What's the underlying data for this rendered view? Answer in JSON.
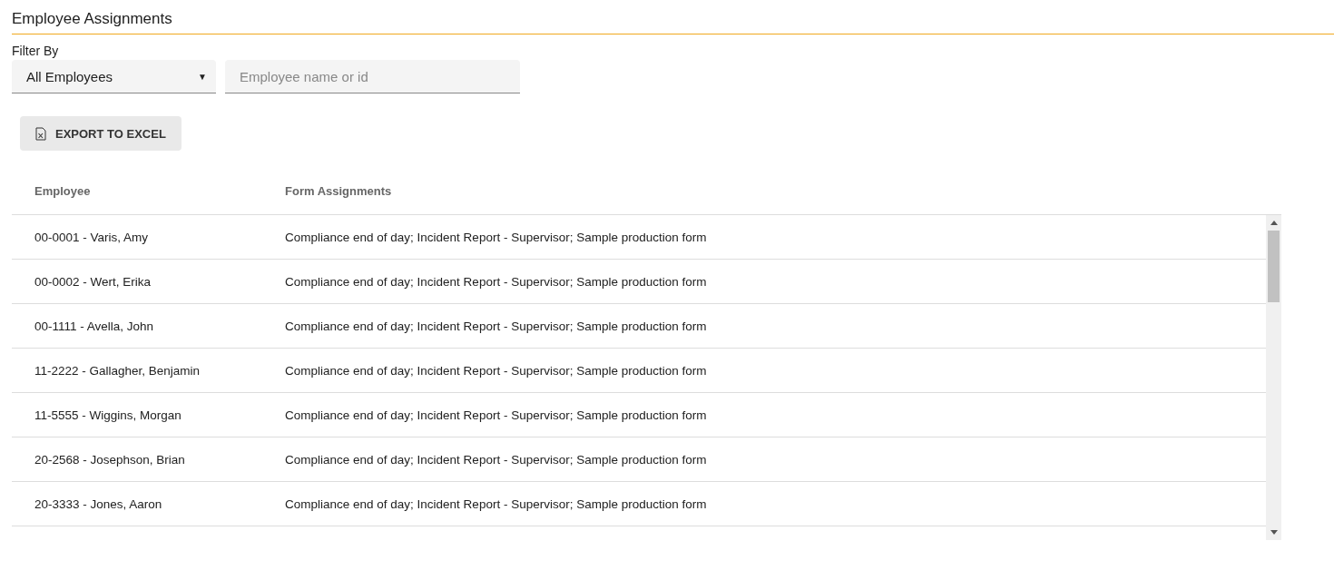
{
  "page_title": "Employee Assignments",
  "filter": {
    "label": "Filter By",
    "dropdown_value": "All Employees",
    "dropdown_caret": "▼",
    "search": {
      "placeholder": "Employee name or id"
    }
  },
  "export_button": {
    "label": "EXPORT TO EXCEL"
  },
  "table": {
    "columns": [
      "Employee",
      "Form Assignments"
    ],
    "rows": [
      {
        "employee": "00-0001 - Varis, Amy",
        "forms": "Compliance end of day; Incident Report - Supervisor; Sample production form"
      },
      {
        "employee": "00-0002 - Wert, Erika",
        "forms": "Compliance end of day; Incident Report - Supervisor; Sample production form"
      },
      {
        "employee": "00-1111 - Avella, John",
        "forms": "Compliance end of day; Incident Report - Supervisor; Sample production form"
      },
      {
        "employee": "11-2222 - Gallagher, Benjamin",
        "forms": "Compliance end of day; Incident Report - Supervisor; Sample production form"
      },
      {
        "employee": "11-5555 - Wiggins, Morgan",
        "forms": "Compliance end of day; Incident Report - Supervisor; Sample production form"
      },
      {
        "employee": "20-2568 - Josephson, Brian",
        "forms": "Compliance end of day; Incident Report - Supervisor; Sample production form"
      },
      {
        "employee": "20-3333 - Jones, Aaron",
        "forms": "Compliance end of day; Incident Report - Supervisor; Sample production form"
      }
    ]
  }
}
